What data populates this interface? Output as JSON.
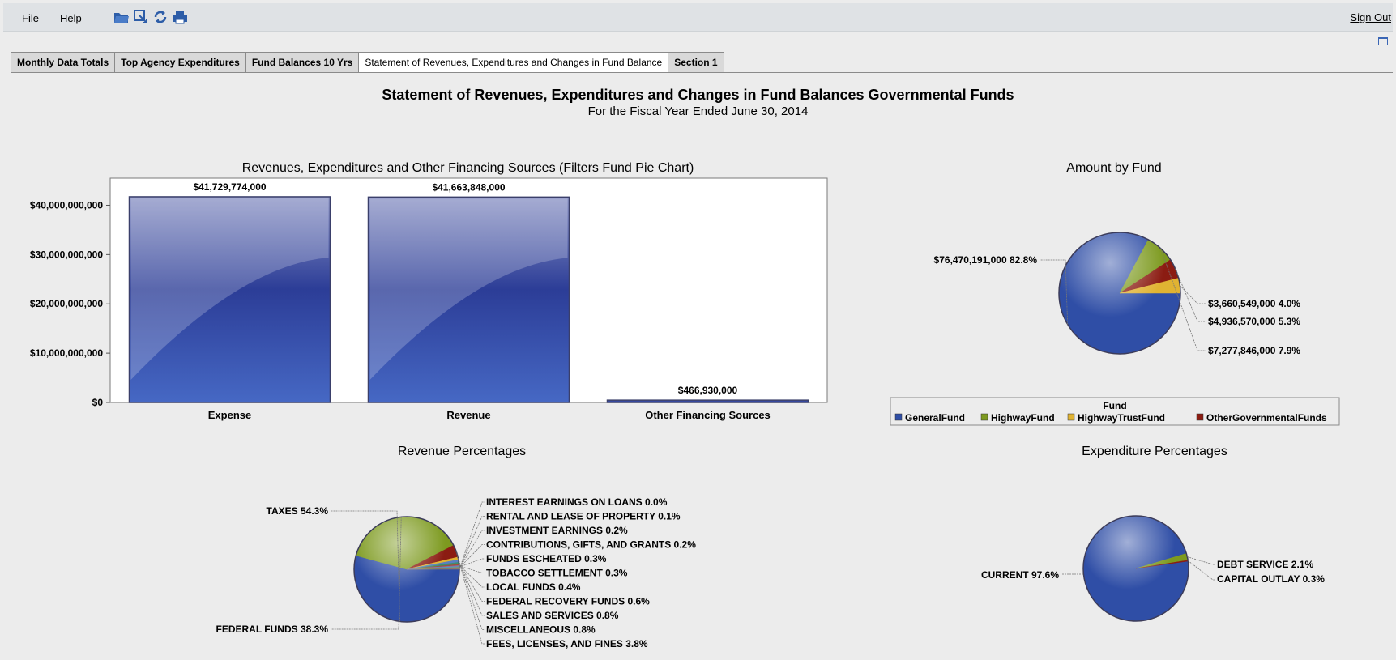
{
  "menu": {
    "file": "File",
    "help": "Help",
    "sign_out": "Sign Out"
  },
  "toolbar_icons": [
    "folder-open-icon",
    "export-icon",
    "refresh-icon",
    "print-icon"
  ],
  "tabs": [
    {
      "label": "Monthly Data Totals",
      "active": false
    },
    {
      "label": "Top Agency Expenditures",
      "active": false
    },
    {
      "label": "Fund Balances 10 Yrs",
      "active": false
    },
    {
      "label": "Statement of Revenues, Expenditures and Changes in Fund Balance",
      "active": true
    },
    {
      "label": "Section 1",
      "active": false
    }
  ],
  "page": {
    "title": "Statement of Revenues, Expenditures and Changes in Fund Balances Governmental Funds",
    "subtitle": "For the Fiscal Year Ended June 30, 2014"
  },
  "colors": {
    "blue": "#2f4ea6",
    "green": "#7d9a1f",
    "gold": "#e0b332",
    "darkred": "#8b1c12"
  },
  "chart_data": [
    {
      "id": "bar",
      "type": "bar",
      "title": "Revenues, Expenditures and Other Financing Sources (Filters Fund Pie Chart)",
      "categories": [
        "Expense",
        "Revenue",
        "Other Financing Sources"
      ],
      "values": [
        41729774000,
        41663848000,
        466930000
      ],
      "value_labels": [
        "$41,729,774,000",
        "$41,663,848,000",
        "$466,930,000"
      ],
      "ylim": [
        0,
        45500000000
      ],
      "yticks": [
        0,
        10000000000,
        20000000000,
        30000000000,
        40000000000
      ],
      "ytick_labels": [
        "$0",
        "$10,000,000,000",
        "$20,000,000,000",
        "$30,000,000,000",
        "$40,000,000,000"
      ]
    },
    {
      "id": "fund",
      "type": "pie",
      "title": "Amount by Fund",
      "legend_title": "Fund",
      "slices": [
        {
          "name": "GeneralFund",
          "value": 76470191000,
          "percent": 82.8,
          "label": "$76,470,191,000 82.8%",
          "color": "#2f4ea6"
        },
        {
          "name": "HighwayFund",
          "value": 7277846000,
          "percent": 7.9,
          "label": "$7,277,846,000 7.9%",
          "color": "#7d9a1f"
        },
        {
          "name": "OtherGovernmentalFunds",
          "value": 4936570000,
          "percent": 5.3,
          "label": "$4,936,570,000 5.3%",
          "color": "#8b1c12"
        },
        {
          "name": "HighwayTrustFund",
          "value": 3660549000,
          "percent": 4.0,
          "label": "$3,660,549,000 4.0%",
          "color": "#e0b332"
        }
      ],
      "legend": [
        "GeneralFund",
        "HighwayFund",
        "HighwayTrustFund",
        "OtherGovernmentalFunds"
      ]
    },
    {
      "id": "revenue",
      "type": "pie",
      "title": "Revenue Percentages",
      "slices": [
        {
          "name": "TAXES",
          "percent": 54.3,
          "label": "TAXES 54.3%",
          "color": "#2f4ea6"
        },
        {
          "name": "FEDERAL FUNDS",
          "percent": 38.3,
          "label": "FEDERAL FUNDS 38.3%",
          "color": "#7d9a1f"
        },
        {
          "name": "FEES, LICENSES, AND FINES",
          "percent": 3.8,
          "label": "FEES, LICENSES, AND FINES 3.8%",
          "color": "#8b1c12"
        },
        {
          "name": "MISCELLANEOUS",
          "percent": 0.8,
          "label": "MISCELLANEOUS 0.8%",
          "color": "#e0b332"
        },
        {
          "name": "SALES AND SERVICES",
          "percent": 0.8,
          "label": "SALES AND SERVICES 0.8%",
          "color": "#5a7fc0"
        },
        {
          "name": "FEDERAL RECOVERY FUNDS",
          "percent": 0.6,
          "label": "FEDERAL RECOVERY FUNDS 0.6%",
          "color": "#3d8f6f"
        },
        {
          "name": "LOCAL FUNDS",
          "percent": 0.4,
          "label": "LOCAL FUNDS 0.4%",
          "color": "#a0503a"
        },
        {
          "name": "TOBACCO SETTLEMENT",
          "percent": 0.3,
          "label": "TOBACCO SETTLEMENT 0.3%",
          "color": "#8a6db0"
        },
        {
          "name": "FUNDS ESCHEATED",
          "percent": 0.3,
          "label": "FUNDS ESCHEATED 0.3%",
          "color": "#4fa0b5"
        },
        {
          "name": "CONTRIBUTIONS, GIFTS, AND GRANTS",
          "percent": 0.2,
          "label": "CONTRIBUTIONS, GIFTS, AND GRANTS 0.2%",
          "color": "#b08a2c"
        },
        {
          "name": "INVESTMENT EARNINGS",
          "percent": 0.2,
          "label": "INVESTMENT EARNINGS 0.2%",
          "color": "#6b8f3a"
        },
        {
          "name": "RENTAL AND LEASE OF PROPERTY",
          "percent": 0.1,
          "label": "RENTAL AND LEASE OF PROPERTY 0.1%",
          "color": "#c06070"
        },
        {
          "name": "INTEREST EARNINGS ON LOANS",
          "percent": 0.0,
          "label": "INTEREST EARNINGS ON LOANS 0.0%",
          "color": "#7a7a7a"
        }
      ]
    },
    {
      "id": "expenditure",
      "type": "pie",
      "title": "Expenditure Percentages",
      "slices": [
        {
          "name": "CURRENT",
          "percent": 97.6,
          "label": "CURRENT 97.6%",
          "color": "#2f4ea6"
        },
        {
          "name": "DEBT SERVICE",
          "percent": 2.1,
          "label": "DEBT SERVICE 2.1%",
          "color": "#7d9a1f"
        },
        {
          "name": "CAPITAL OUTLAY",
          "percent": 0.3,
          "label": "CAPITAL OUTLAY 0.3%",
          "color": "#8b1c12"
        }
      ]
    }
  ]
}
